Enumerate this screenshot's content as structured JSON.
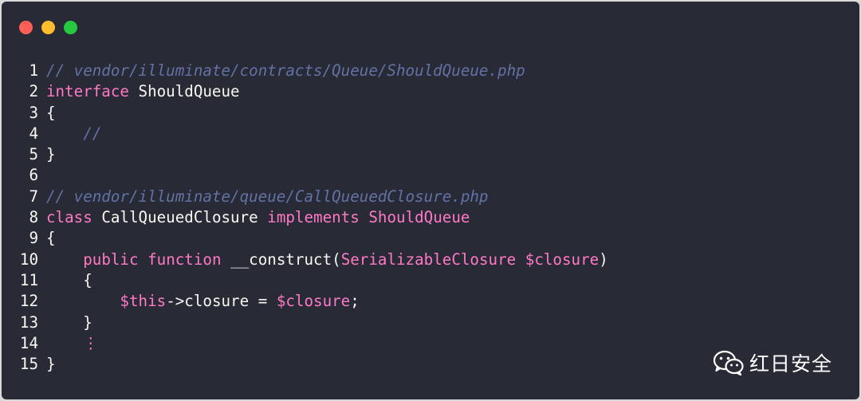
{
  "window": {
    "background": "#282a36",
    "traffic_lights": [
      {
        "name": "close",
        "color": "#ff5f56"
      },
      {
        "name": "minimize",
        "color": "#ffbd2e"
      },
      {
        "name": "maximize",
        "color": "#27c93f"
      }
    ]
  },
  "colors": {
    "line_number": "#f8f8f2",
    "comment": "#6272a4",
    "keyword": "#ff79c6",
    "plain": "#f8f8f2",
    "ellipsis": "#ff79c6"
  },
  "code_lines": [
    {
      "number": "1",
      "tokens": [
        {
          "text": "// vendor/illuminate/contracts/Queue/ShouldQueue.php",
          "kind": "comment"
        }
      ]
    },
    {
      "number": "2",
      "tokens": [
        {
          "text": "interface",
          "kind": "keyword"
        },
        {
          "text": " ShouldQueue",
          "kind": "plain"
        }
      ]
    },
    {
      "number": "3",
      "tokens": [
        {
          "text": "{",
          "kind": "plain"
        }
      ]
    },
    {
      "number": "4",
      "tokens": [
        {
          "text": "    ",
          "kind": "plain"
        },
        {
          "text": "//",
          "kind": "comment"
        }
      ]
    },
    {
      "number": "5",
      "tokens": [
        {
          "text": "}",
          "kind": "plain"
        }
      ]
    },
    {
      "number": "6",
      "tokens": []
    },
    {
      "number": "7",
      "tokens": [
        {
          "text": "// vendor/illuminate/queue/CallQueuedClosure.php",
          "kind": "comment"
        }
      ]
    },
    {
      "number": "8",
      "tokens": [
        {
          "text": "class",
          "kind": "keyword"
        },
        {
          "text": " CallQueuedClosure ",
          "kind": "plain"
        },
        {
          "text": "implements",
          "kind": "keyword"
        },
        {
          "text": " ",
          "kind": "plain"
        },
        {
          "text": "ShouldQueue",
          "kind": "keyword"
        }
      ]
    },
    {
      "number": "9",
      "tokens": [
        {
          "text": "{",
          "kind": "plain"
        }
      ]
    },
    {
      "number": "10",
      "tokens": [
        {
          "text": "    ",
          "kind": "plain"
        },
        {
          "text": "public",
          "kind": "keyword"
        },
        {
          "text": " ",
          "kind": "plain"
        },
        {
          "text": "function",
          "kind": "keyword"
        },
        {
          "text": " __construct(",
          "kind": "plain"
        },
        {
          "text": "SerializableClosure",
          "kind": "keyword"
        },
        {
          "text": " ",
          "kind": "plain"
        },
        {
          "text": "$closure",
          "kind": "keyword"
        },
        {
          "text": ")",
          "kind": "plain"
        }
      ]
    },
    {
      "number": "11",
      "tokens": [
        {
          "text": "    {",
          "kind": "plain"
        }
      ]
    },
    {
      "number": "12",
      "tokens": [
        {
          "text": "        ",
          "kind": "plain"
        },
        {
          "text": "$this",
          "kind": "keyword"
        },
        {
          "text": "->closure = ",
          "kind": "plain"
        },
        {
          "text": "$closure",
          "kind": "keyword"
        },
        {
          "text": ";",
          "kind": "plain"
        }
      ]
    },
    {
      "number": "13",
      "tokens": [
        {
          "text": "    }",
          "kind": "plain"
        }
      ]
    },
    {
      "number": "14",
      "tokens": [
        {
          "text": "    ",
          "kind": "plain"
        },
        {
          "text": "⋮",
          "kind": "ellipsis"
        }
      ]
    },
    {
      "number": "15",
      "tokens": [
        {
          "text": "}",
          "kind": "plain"
        }
      ]
    }
  ],
  "watermark": {
    "icon": "wechat-icon",
    "text": "红日安全"
  }
}
